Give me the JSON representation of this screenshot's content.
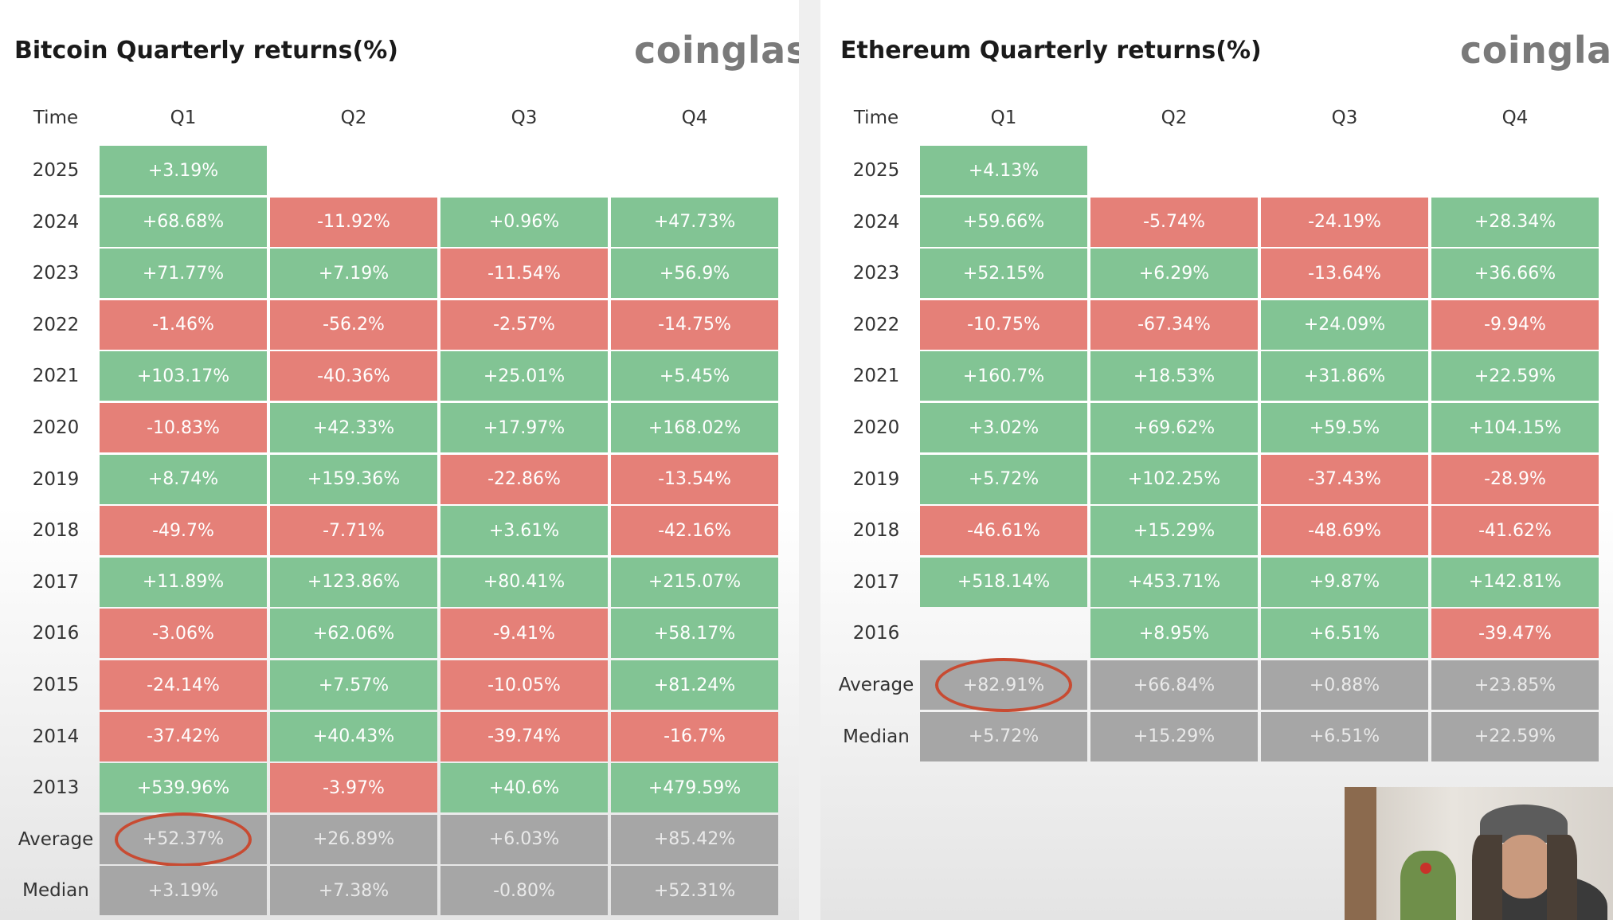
{
  "charts": [
    {
      "brand": "coinglass",
      "title": "Bitcoin Quarterly returns(%)",
      "header": [
        "Time",
        "Q1",
        "Q2",
        "Q3",
        "Q4"
      ],
      "rows": [
        {
          "label": "2025",
          "values": [
            "+3.19%",
            "",
            "",
            ""
          ]
        },
        {
          "label": "2024",
          "values": [
            "+68.68%",
            "-11.92%",
            "+0.96%",
            "+47.73%"
          ]
        },
        {
          "label": "2023",
          "values": [
            "+71.77%",
            "+7.19%",
            "-11.54%",
            "+56.9%"
          ]
        },
        {
          "label": "2022",
          "values": [
            "-1.46%",
            "-56.2%",
            "-2.57%",
            "-14.75%"
          ]
        },
        {
          "label": "2021",
          "values": [
            "+103.17%",
            "-40.36%",
            "+25.01%",
            "+5.45%"
          ]
        },
        {
          "label": "2020",
          "values": [
            "-10.83%",
            "+42.33%",
            "+17.97%",
            "+168.02%"
          ]
        },
        {
          "label": "2019",
          "values": [
            "+8.74%",
            "+159.36%",
            "-22.86%",
            "-13.54%"
          ]
        },
        {
          "label": "2018",
          "values": [
            "-49.7%",
            "-7.71%",
            "+3.61%",
            "-42.16%"
          ]
        },
        {
          "label": "2017",
          "values": [
            "+11.89%",
            "+123.86%",
            "+80.41%",
            "+215.07%"
          ]
        },
        {
          "label": "2016",
          "values": [
            "-3.06%",
            "+62.06%",
            "-9.41%",
            "+58.17%"
          ]
        },
        {
          "label": "2015",
          "values": [
            "-24.14%",
            "+7.57%",
            "-10.05%",
            "+81.24%"
          ]
        },
        {
          "label": "2014",
          "values": [
            "-37.42%",
            "+40.43%",
            "-39.74%",
            "-16.7%"
          ]
        },
        {
          "label": "2013",
          "values": [
            "+539.96%",
            "-3.97%",
            "+40.6%",
            "+479.59%"
          ]
        },
        {
          "label": "Average",
          "summary": true,
          "values": [
            "+52.37%",
            "+26.89%",
            "+6.03%",
            "+85.42%"
          ]
        },
        {
          "label": "Median",
          "summary": true,
          "values": [
            "+3.19%",
            "+7.38%",
            "-0.80%",
            "+52.31%"
          ]
        }
      ],
      "highlight": {
        "row": "Average",
        "col": 0
      }
    },
    {
      "brand": "coinglass",
      "title": "Ethereum Quarterly returns(%)",
      "header": [
        "Time",
        "Q1",
        "Q2",
        "Q3",
        "Q4"
      ],
      "rows": [
        {
          "label": "2025",
          "values": [
            "+4.13%",
            "",
            "",
            ""
          ]
        },
        {
          "label": "2024",
          "values": [
            "+59.66%",
            "-5.74%",
            "-24.19%",
            "+28.34%"
          ]
        },
        {
          "label": "2023",
          "values": [
            "+52.15%",
            "+6.29%",
            "-13.64%",
            "+36.66%"
          ]
        },
        {
          "label": "2022",
          "values": [
            "-10.75%",
            "-67.34%",
            "+24.09%",
            "-9.94%"
          ]
        },
        {
          "label": "2021",
          "values": [
            "+160.7%",
            "+18.53%",
            "+31.86%",
            "+22.59%"
          ]
        },
        {
          "label": "2020",
          "values": [
            "+3.02%",
            "+69.62%",
            "+59.5%",
            "+104.15%"
          ]
        },
        {
          "label": "2019",
          "values": [
            "+5.72%",
            "+102.25%",
            "-37.43%",
            "-28.9%"
          ]
        },
        {
          "label": "2018",
          "values": [
            "-46.61%",
            "+15.29%",
            "-48.69%",
            "-41.62%"
          ]
        },
        {
          "label": "2017",
          "values": [
            "+518.14%",
            "+453.71%",
            "+9.87%",
            "+142.81%"
          ]
        },
        {
          "label": "2016",
          "values": [
            "",
            "+8.95%",
            "+6.51%",
            "-39.47%"
          ]
        },
        {
          "label": "Average",
          "summary": true,
          "values": [
            "+82.91%",
            "+66.84%",
            "+0.88%",
            "+23.85%"
          ]
        },
        {
          "label": "Median",
          "summary": true,
          "values": [
            "+5.72%",
            "+15.29%",
            "+6.51%",
            "+22.59%"
          ]
        }
      ],
      "highlight": {
        "row": "Average",
        "col": 0
      }
    }
  ],
  "chart_data": [
    {
      "type": "table",
      "title": "Bitcoin Quarterly returns(%)",
      "columns": [
        "Q1",
        "Q2",
        "Q3",
        "Q4"
      ],
      "rows": [
        "2025",
        "2024",
        "2023",
        "2022",
        "2021",
        "2020",
        "2019",
        "2018",
        "2017",
        "2016",
        "2015",
        "2014",
        "2013",
        "Average",
        "Median"
      ],
      "values": [
        [
          3.19,
          null,
          null,
          null
        ],
        [
          68.68,
          -11.92,
          0.96,
          47.73
        ],
        [
          71.77,
          7.19,
          -11.54,
          56.9
        ],
        [
          -1.46,
          -56.2,
          -2.57,
          -14.75
        ],
        [
          103.17,
          -40.36,
          25.01,
          5.45
        ],
        [
          -10.83,
          42.33,
          17.97,
          168.02
        ],
        [
          8.74,
          159.36,
          -22.86,
          -13.54
        ],
        [
          -49.7,
          -7.71,
          3.61,
          -42.16
        ],
        [
          11.89,
          123.86,
          80.41,
          215.07
        ],
        [
          -3.06,
          62.06,
          -9.41,
          58.17
        ],
        [
          -24.14,
          7.57,
          -10.05,
          81.24
        ],
        [
          -37.42,
          40.43,
          -39.74,
          -16.7
        ],
        [
          539.96,
          -3.97,
          40.6,
          479.59
        ],
        [
          52.37,
          26.89,
          6.03,
          85.42
        ],
        [
          3.19,
          7.38,
          -0.8,
          52.31
        ]
      ],
      "colors": {
        "positive": "#82c494",
        "negative": "#e58078",
        "summary": "#a6a6a6"
      }
    },
    {
      "type": "table",
      "title": "Ethereum Quarterly returns(%)",
      "columns": [
        "Q1",
        "Q2",
        "Q3",
        "Q4"
      ],
      "rows": [
        "2025",
        "2024",
        "2023",
        "2022",
        "2021",
        "2020",
        "2019",
        "2018",
        "2017",
        "2016",
        "Average",
        "Median"
      ],
      "values": [
        [
          4.13,
          null,
          null,
          null
        ],
        [
          59.66,
          -5.74,
          -24.19,
          28.34
        ],
        [
          52.15,
          6.29,
          -13.64,
          36.66
        ],
        [
          -10.75,
          -67.34,
          24.09,
          -9.94
        ],
        [
          160.7,
          18.53,
          31.86,
          22.59
        ],
        [
          3.02,
          69.62,
          59.5,
          104.15
        ],
        [
          5.72,
          102.25,
          -37.43,
          -28.9
        ],
        [
          -46.61,
          15.29,
          -48.69,
          -41.62
        ],
        [
          518.14,
          453.71,
          9.87,
          142.81
        ],
        [
          null,
          8.95,
          6.51,
          -39.47
        ],
        [
          82.91,
          66.84,
          0.88,
          23.85
        ],
        [
          5.72,
          15.29,
          6.51,
          22.59
        ]
      ],
      "colors": {
        "positive": "#82c494",
        "negative": "#e58078",
        "summary": "#a6a6a6"
      }
    }
  ]
}
